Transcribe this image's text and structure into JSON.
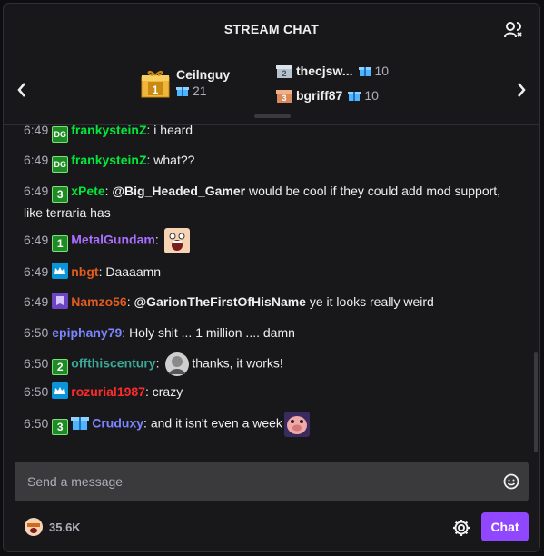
{
  "header": {
    "title": "STREAM CHAT"
  },
  "leaderboard": {
    "first": {
      "rank": "1",
      "name": "Ceilnguy",
      "count": "21"
    },
    "others": [
      {
        "rank": "2",
        "name": "thecjsw...",
        "count": "10"
      },
      {
        "rank": "3",
        "name": "bgriff87",
        "count": "10"
      }
    ]
  },
  "colors": {
    "accent": "#9147ff",
    "green": "#00e838",
    "purple": "#a970ff",
    "orange": "#e05b1d",
    "blue": "#7a85ff",
    "teal": "#39a896",
    "red": "#ff2b2b"
  },
  "messages": [
    {
      "time": "6:49",
      "badges": [
        "DG"
      ],
      "user": "frankysteinZ",
      "text": "i heard"
    },
    {
      "time": "6:49",
      "badges": [
        "DG"
      ],
      "user": "frankysteinZ",
      "text": "what??"
    },
    {
      "time": "6:49",
      "badges": [
        "3"
      ],
      "user": "xPete",
      "mention": "@Big_Headed_Gamer",
      "text": " would be cool if they could add mod support, like terraria has"
    },
    {
      "time": "6:49",
      "badges": [
        "1"
      ],
      "user": "MetalGundam",
      "text": "",
      "emote": "surprised-face-emote"
    },
    {
      "time": "6:49",
      "badges": [
        "crown"
      ],
      "user": "nbgt",
      "text": "Daaaamn"
    },
    {
      "time": "6:49",
      "badges": [
        "mod"
      ],
      "user": "Namzo56",
      "mention": "@GarionTheFirstOfHisName",
      "text": " ye it looks really weird"
    },
    {
      "time": "6:50",
      "badges": [],
      "user": "epiphany79",
      "text": "Holy shit ... 1 million .... damn"
    },
    {
      "time": "6:50",
      "badges": [
        "2"
      ],
      "user": "offthiscentury",
      "text": "thanks, it works!",
      "emote": "face-emote"
    },
    {
      "time": "6:50",
      "badges": [
        "crown"
      ],
      "user": "rozurial1987",
      "text": "crazy"
    },
    {
      "time": "6:50",
      "badges": [
        "3",
        "gift"
      ],
      "user": "Cruduxy",
      "text": "and it isn't even a week",
      "emote": "pig-face-emote"
    }
  ],
  "input": {
    "placeholder": "Send a message"
  },
  "footer": {
    "points": "35.6K",
    "chat_label": "Chat"
  }
}
